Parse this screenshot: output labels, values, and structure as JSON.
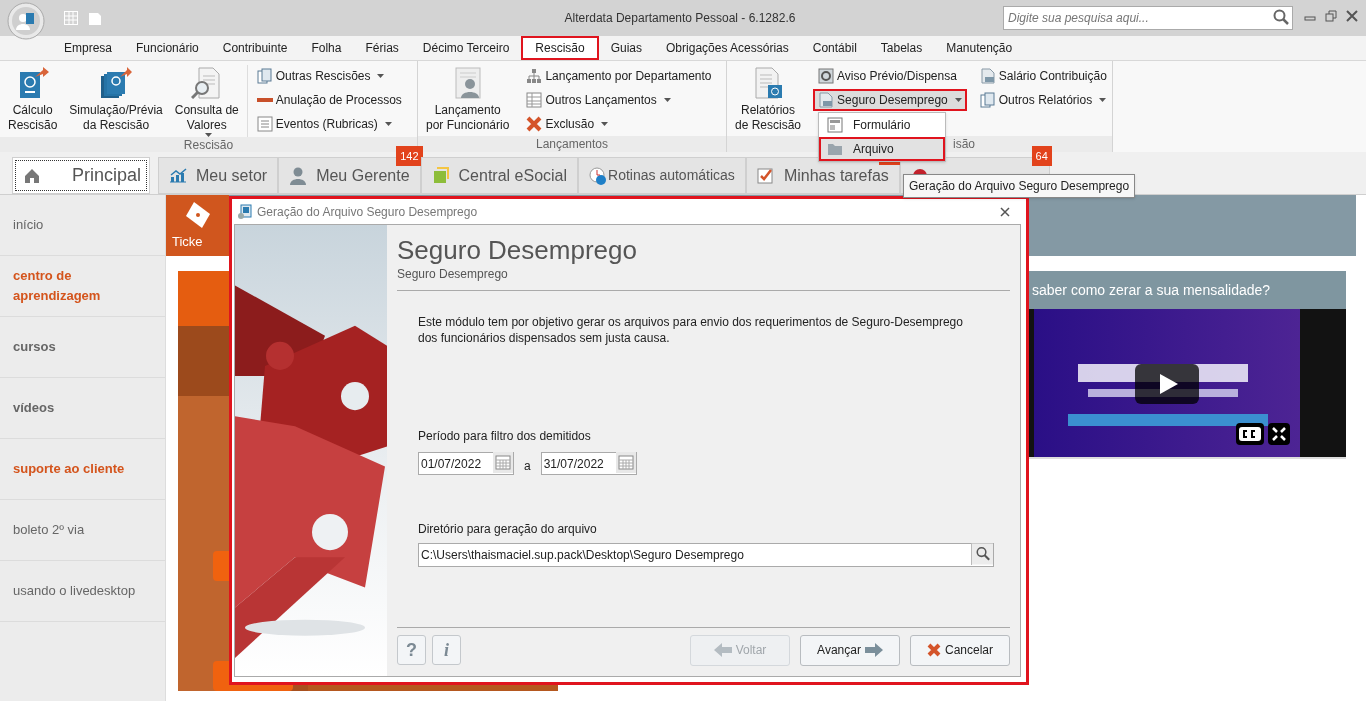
{
  "window": {
    "title": "Alterdata Departamento Pessoal - 6.1282.6",
    "search": {
      "placeholder": "Digite sua pesquisa aqui..."
    }
  },
  "menu": [
    {
      "label": "Empresa",
      "selected": false
    },
    {
      "label": "Funcionário",
      "selected": false
    },
    {
      "label": "Contribuinte",
      "selected": false
    },
    {
      "label": "Folha",
      "selected": false
    },
    {
      "label": "Férias",
      "selected": false
    },
    {
      "label": "Décimo Terceiro",
      "selected": false
    },
    {
      "label": "Rescisão",
      "selected": true
    },
    {
      "label": "Guias",
      "selected": false
    },
    {
      "label": "Obrigações Acessórias",
      "selected": false
    },
    {
      "label": "Contábil",
      "selected": false
    },
    {
      "label": "Tabelas",
      "selected": false
    },
    {
      "label": "Manutenção",
      "selected": false
    }
  ],
  "ribbon": [
    {
      "label": "Rescisão",
      "large": [
        {
          "label": "Cálculo\nRescisão",
          "kind": "passport",
          "dropdown": false
        },
        {
          "label": "Simulação/Prévia\nda Rescisão",
          "kind": "passports",
          "dropdown": false
        },
        {
          "label": "Consulta de\nValores",
          "kind": "magnifier",
          "dropdown": true
        }
      ],
      "columns": [
        [
          {
            "label": "Outras Rescisões",
            "kind": "pages",
            "dropdown": true,
            "open": false
          },
          {
            "label": "Anulação de Processos",
            "kind": "dash",
            "dropdown": false,
            "open": false
          },
          {
            "label": "Eventos (Rubricas)",
            "kind": "list",
            "dropdown": true,
            "open": false
          }
        ]
      ]
    },
    {
      "label": "Lançamentos",
      "large": [
        {
          "label": "Lançamento\npor Funcionário",
          "kind": "person",
          "dropdown": false
        }
      ],
      "columns": [
        [
          {
            "label": "Lançamento por Departamento",
            "kind": "tree",
            "dropdown": false,
            "open": false
          },
          {
            "label": "Outros Lançamentos",
            "kind": "table",
            "dropdown": true,
            "open": false
          },
          {
            "label": "Exclusão",
            "kind": "cross",
            "dropdown": true,
            "open": false
          }
        ]
      ]
    },
    {
      "label": "isão",
      "large": [
        {
          "label": "Relatórios\nde Rescisão",
          "kind": "report",
          "dropdown": false
        }
      ],
      "columns": [
        [
          {
            "label": "Aviso Prévio/Dispensa",
            "kind": "gear",
            "dropdown": false,
            "open": false
          },
          {
            "label": "Seguro Desemprego",
            "kind": "money",
            "dropdown": true,
            "open": true
          }
        ],
        [
          {
            "label": "Salário Contribuição",
            "kind": "money",
            "dropdown": false,
            "open": false
          },
          {
            "label": "Outros Relatórios",
            "kind": "pages",
            "dropdown": true,
            "open": false
          }
        ]
      ]
    }
  ],
  "dropdown": [
    {
      "label": "Formulário",
      "kind": "form",
      "selected": false
    },
    {
      "label": "Arquivo",
      "kind": "folder",
      "selected": true
    }
  ],
  "tabs": [
    {
      "label": "Principal",
      "kind": "home",
      "selected": true,
      "alert": false
    },
    {
      "label": "Meu setor",
      "kind": "chart",
      "selected": false,
      "alert": false
    },
    {
      "label": "Meu Gerente",
      "kind": "person",
      "selected": false,
      "alert": false,
      "badge": "142"
    },
    {
      "label": "Central eSocial",
      "kind": "esocial",
      "selected": false,
      "alert": false
    },
    {
      "label": "Rotinas automáticas",
      "kind": "clock",
      "selected": false,
      "alert": false
    },
    {
      "label": "Minhas tarefas",
      "kind": "check",
      "selected": false,
      "alert": true
    },
    {
      "kind": "dot",
      "selected": false,
      "alert": false,
      "badge": "64"
    }
  ],
  "tooltip": "Geração do Arquivo Seguro Desemprego",
  "sidebar": [
    {
      "label": "início",
      "kind": "plain"
    },
    {
      "label": "centro de aprendizagem",
      "kind": "accent"
    },
    {
      "label": "cursos",
      "kind": "bold"
    },
    {
      "label": "vídeos",
      "kind": "bold"
    },
    {
      "label": "suporte ao cliente",
      "kind": "accent"
    },
    {
      "label": "boleto 2º via",
      "kind": "plain"
    },
    {
      "label": "usando o livedesktop",
      "kind": "plain"
    }
  ],
  "content": {
    "tile": "Ticke",
    "video_card": {
      "title": "saber como zerar a sua mensalidade?"
    }
  },
  "dialog": {
    "title": "Geração do Arquivo Seguro Desemprego",
    "heading": "Seguro Desemprego",
    "subheading": "Seguro Desemprego",
    "description": "Este módulo tem por objetivo gerar os arquivos para envio dos requerimentos de Seguro-Desemprego\ndos funcionários dispensados sem justa causa.",
    "period": {
      "label": "Período para filtro dos demitidos",
      "from": "01/07/2022",
      "separator": "a",
      "to": "31/07/2022"
    },
    "directory": {
      "label": "Diretório para geração do arquivo",
      "value": "C:\\Users\\thaismaciel.sup.pack\\Desktop\\Seguro Desemprego"
    },
    "help_buttons": [
      {
        "label": "?"
      },
      {
        "label": "i"
      }
    ],
    "buttons": [
      {
        "label": "Voltar",
        "kind": "back",
        "disabled": true
      },
      {
        "label": "Avançar",
        "kind": "next",
        "disabled": false
      },
      {
        "label": "Cancelar",
        "kind": "cancel",
        "disabled": false
      }
    ]
  }
}
